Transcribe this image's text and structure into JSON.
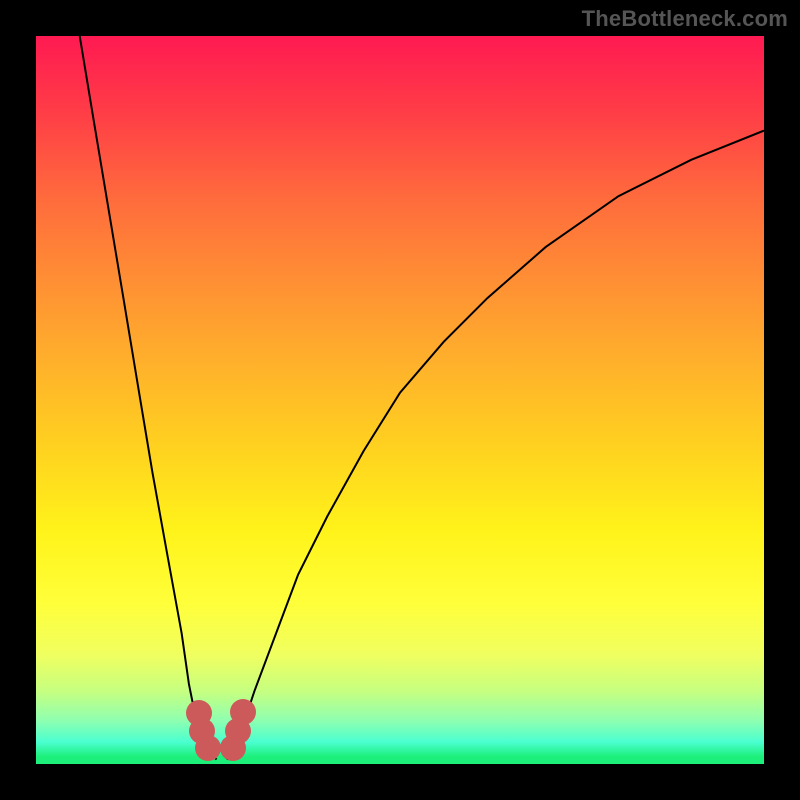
{
  "watermark": "TheBottleneck.com",
  "chart_data": {
    "type": "line",
    "title": "",
    "xlabel": "",
    "ylabel": "",
    "xlim": [
      0,
      100
    ],
    "ylim": [
      0,
      100
    ],
    "grid": false,
    "legend": false,
    "gradient_colors": {
      "top": "#ff1a52",
      "mid_upper": "#ff8a35",
      "mid": "#ffd020",
      "mid_lower": "#fff31a",
      "bottom": "#1cf07a"
    },
    "series": [
      {
        "name": "curve-left",
        "x": [
          6,
          8,
          10,
          12,
          14,
          16,
          18,
          20,
          21,
          22,
          23,
          24
        ],
        "values": [
          100,
          88,
          76,
          64,
          52,
          40,
          29,
          18,
          11,
          6,
          3,
          1.5
        ]
      },
      {
        "name": "curve-right",
        "x": [
          27,
          28,
          30,
          33,
          36,
          40,
          45,
          50,
          56,
          62,
          70,
          80,
          90,
          100
        ],
        "values": [
          1.5,
          4,
          10,
          18,
          26,
          34,
          43,
          51,
          58,
          64,
          71,
          78,
          83,
          87
        ]
      }
    ],
    "markers": {
      "color": "#cc5a5a",
      "points": [
        {
          "x": 22.4,
          "y": 7.0
        },
        {
          "x": 22.8,
          "y": 4.5
        },
        {
          "x": 23.6,
          "y": 2.2
        },
        {
          "x": 27.0,
          "y": 2.2
        },
        {
          "x": 27.8,
          "y": 4.6
        },
        {
          "x": 28.4,
          "y": 7.2
        }
      ]
    },
    "annotations": []
  }
}
